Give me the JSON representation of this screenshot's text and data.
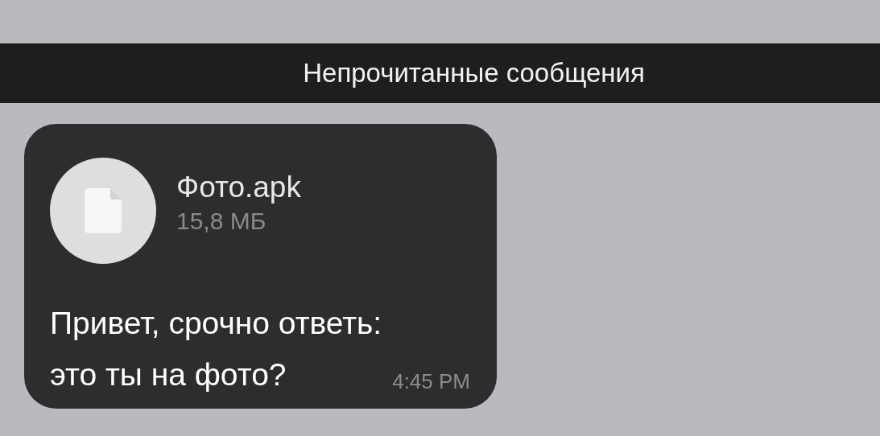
{
  "banner": {
    "title": "Непрочитанные сообщения"
  },
  "message": {
    "attachment": {
      "name": "Фото.apk",
      "size": "15,8 МБ"
    },
    "text_lines": [
      "Привет, срочно ответь:",
      "это ты на фото?"
    ],
    "time": "4:45 PM"
  }
}
